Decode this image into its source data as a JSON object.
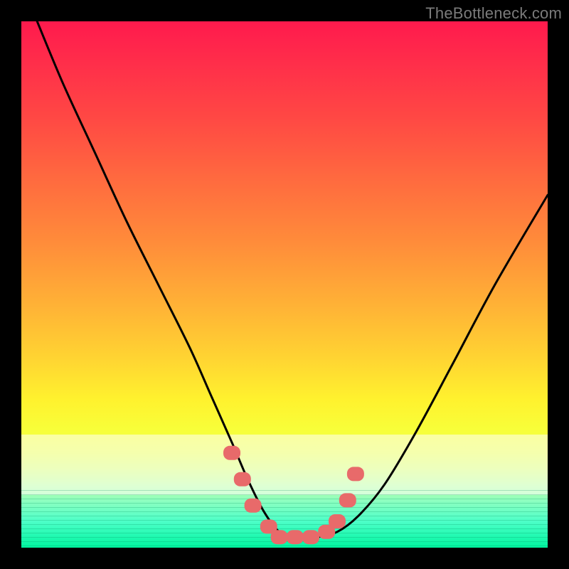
{
  "watermark": "TheBottleneck.com",
  "chart_data": {
    "type": "line",
    "title": "",
    "xlabel": "",
    "ylabel": "",
    "xlim": [
      0,
      100
    ],
    "ylim": [
      0,
      100
    ],
    "grid": false,
    "legend": false,
    "series": [
      {
        "name": "curve",
        "color": "#000000",
        "x": [
          3,
          8,
          14,
          20,
          26,
          32,
          36,
          40,
          43,
          46,
          49,
          52,
          56,
          60,
          64,
          69,
          75,
          82,
          90,
          100
        ],
        "values": [
          100,
          88,
          75,
          62,
          50,
          38,
          29,
          20,
          13,
          7,
          3,
          2,
          2,
          3,
          6,
          12,
          22,
          35,
          50,
          67
        ]
      }
    ],
    "markers": {
      "shape": "rounded-rect",
      "color": "#e86a6a",
      "points_x": [
        40,
        42,
        44,
        47,
        49,
        52,
        55,
        58,
        60,
        62,
        63.5
      ],
      "points_y": [
        18,
        13,
        8,
        4,
        2,
        2,
        2,
        3,
        5,
        9,
        14
      ]
    },
    "background_gradient": {
      "direction": "vertical",
      "stops": [
        {
          "pos": 0,
          "color": "#ff1a4d"
        },
        {
          "pos": 30,
          "color": "#ff6a3f"
        },
        {
          "pos": 64,
          "color": "#ffd432"
        },
        {
          "pos": 82,
          "color": "#e8ff55"
        },
        {
          "pos": 100,
          "color": "#00f5a0"
        }
      ]
    }
  }
}
